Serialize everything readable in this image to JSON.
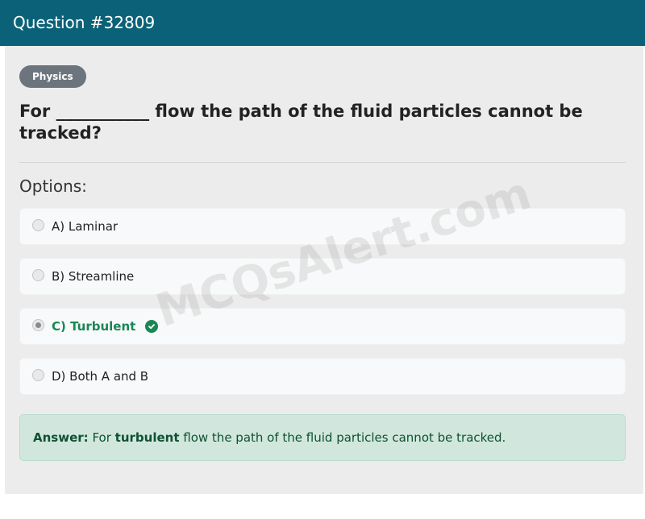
{
  "header": {
    "title": "Question #32809"
  },
  "badge": {
    "label": "Physics"
  },
  "question": {
    "text": "For ___________ flow the path of the fluid particles cannot be tracked?"
  },
  "options_label": "Options:",
  "options": [
    {
      "label": "A) Laminar",
      "selected": false,
      "correct": false
    },
    {
      "label": "B) Streamline",
      "selected": false,
      "correct": false
    },
    {
      "label": "C) Turbulent",
      "selected": true,
      "correct": true
    },
    {
      "label": "D) Both A and B",
      "selected": false,
      "correct": false
    }
  ],
  "answer": {
    "prefix": "Answer:",
    "before": "For",
    "keyword": "turbulent",
    "after": "flow the path of the fluid particles cannot be tracked."
  },
  "watermark": "MCQsAlert.com",
  "icons": {
    "correct": "check-circle-icon",
    "radio": "radio-icon"
  },
  "colors": {
    "header": "#0b6278",
    "correct": "#198754",
    "answer_bg": "#d1e7dd",
    "badge": "#6c757d"
  }
}
